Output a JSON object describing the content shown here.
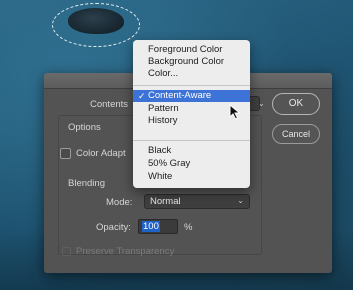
{
  "dialog": {
    "contents_label": "Contents",
    "options_title": "Options",
    "color_adapt_label": "Color Adapt",
    "blending_title": "Blending",
    "mode_label": "Mode:",
    "mode_value": "Normal",
    "opacity_label": "Opacity:",
    "opacity_value": "100",
    "opacity_unit": "%",
    "preserve_label": "Preserve Transparency",
    "ok_label": "OK",
    "cancel_label": "Cancel"
  },
  "menu": {
    "group1": [
      "Foreground Color",
      "Background Color",
      "Color..."
    ],
    "selected": "Content-Aware",
    "selected_check": "✓",
    "group2": [
      "Pattern",
      "History"
    ],
    "group3": [
      "Black",
      "50% Gray",
      "White"
    ]
  },
  "colors": {
    "dialog_bg": "#535353",
    "menu_bg": "#ededed",
    "highlight": "#3d73d6",
    "input_highlight": "#1f63c9"
  },
  "icons": {
    "checkmark": "checkmark-icon",
    "chevron": "chevron-down-icon",
    "cursor": "mouse-pointer-icon"
  }
}
